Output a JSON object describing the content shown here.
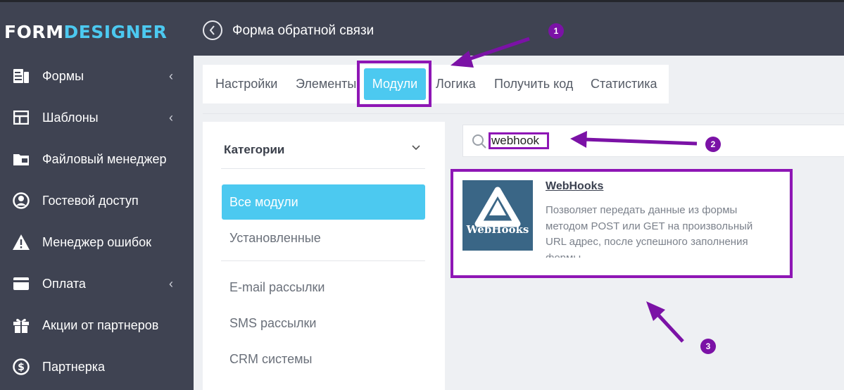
{
  "logo": {
    "part1": "FORM",
    "part2": "DESIGNER"
  },
  "sidebar": {
    "items": [
      {
        "label": "Формы",
        "icon": "forms-icon",
        "has_submenu": true
      },
      {
        "label": "Шаблоны",
        "icon": "templates-icon",
        "has_submenu": true
      },
      {
        "label": "Файловый менеджер",
        "icon": "folder-icon",
        "has_submenu": false
      },
      {
        "label": "Гостевой доступ",
        "icon": "user-circle-icon",
        "has_submenu": false
      },
      {
        "label": "Менеджер ошибок",
        "icon": "warning-icon",
        "has_submenu": false
      },
      {
        "label": "Оплата",
        "icon": "credit-card-icon",
        "has_submenu": true
      },
      {
        "label": "Акции от партнеров",
        "icon": "gift-icon",
        "has_submenu": false
      },
      {
        "label": "Партнерка",
        "icon": "dollar-icon",
        "has_submenu": false
      }
    ]
  },
  "header": {
    "title": "Форма обратной связи"
  },
  "tabs": [
    {
      "label": "Настройки"
    },
    {
      "label": "Элементы"
    },
    {
      "label": "Модули",
      "active": true
    },
    {
      "label": "Логика"
    },
    {
      "label": "Получить код"
    },
    {
      "label": "Статистика"
    }
  ],
  "categories": {
    "title": "Категории",
    "items": [
      {
        "label": "Все модули",
        "active": true
      },
      {
        "label": "Установленные"
      },
      {
        "label": "E-mail рассылки"
      },
      {
        "label": "SMS рассылки"
      },
      {
        "label": "CRM системы"
      }
    ]
  },
  "search": {
    "value": "webhook"
  },
  "module": {
    "title": "WebHooks",
    "logo_text": "WebHooks",
    "description": "Позволяет передать данные из формы методом POST или GET на произвольный URL адрес, после успешного заполнения формы"
  },
  "annotations": {
    "badge1": "1",
    "badge2": "2",
    "badge3": "3"
  },
  "colors": {
    "accent": "#4cc9f0",
    "sidebar": "#3f4352",
    "highlight": "#8e16b5",
    "badge": "#7b12a6"
  }
}
